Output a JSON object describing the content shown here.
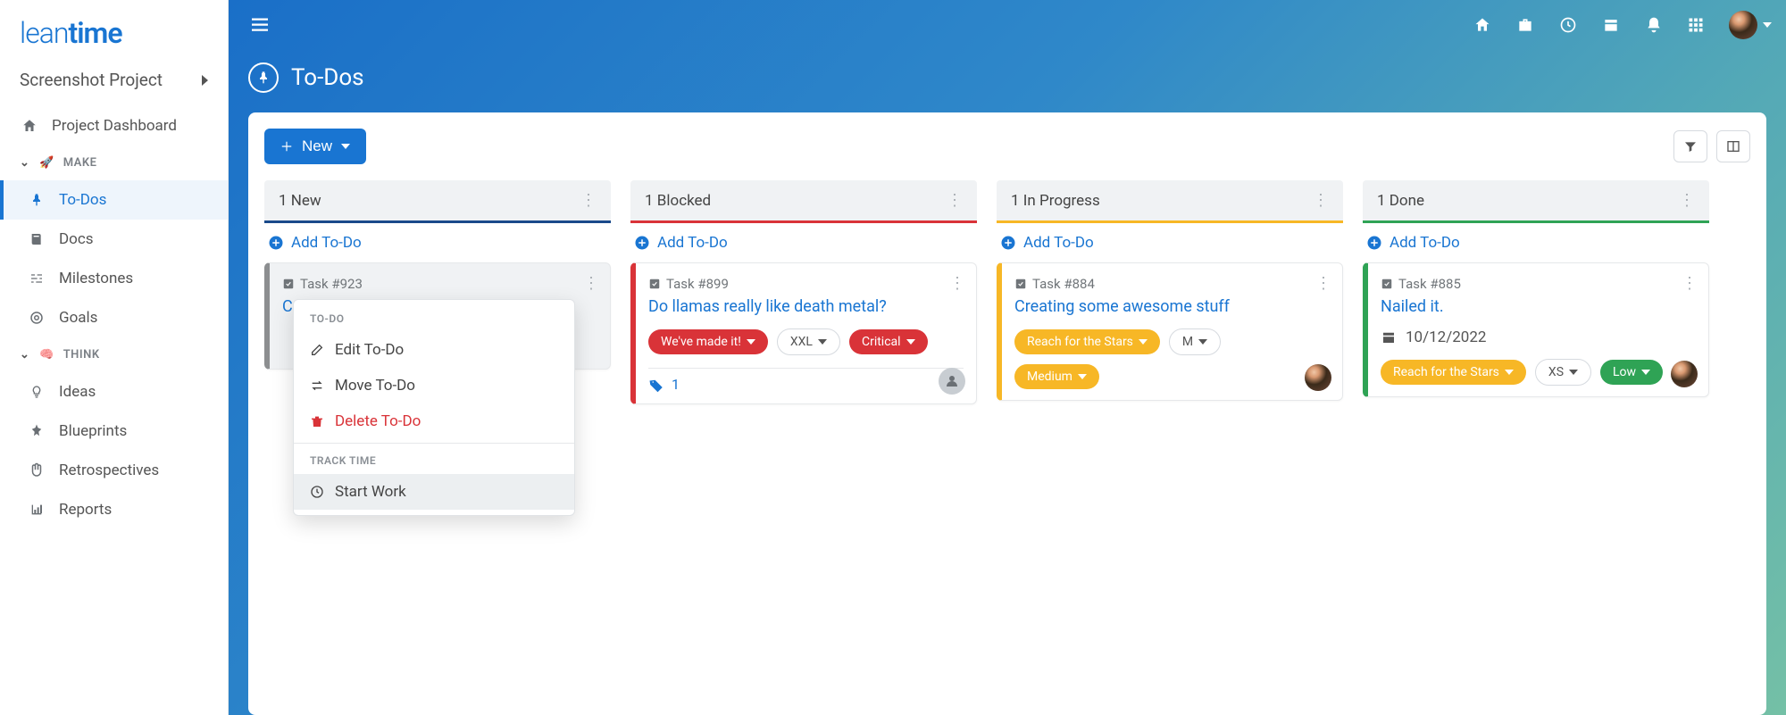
{
  "logo": {
    "part1": "lean",
    "part2": "time"
  },
  "project": "Screenshot Project",
  "sidebar": {
    "dashboard": "Project Dashboard",
    "make": {
      "label": "MAKE",
      "todos": "To-Dos",
      "docs": "Docs",
      "milestones": "Milestones",
      "goals": "Goals"
    },
    "think": {
      "label": "THINK",
      "ideas": "Ideas",
      "blueprints": "Blueprints",
      "retros": "Retrospectives",
      "reports": "Reports"
    }
  },
  "page": {
    "title": "To-Dos",
    "newBtn": "New"
  },
  "columns": {
    "new": {
      "title": "1 New",
      "add": "Add To-Do",
      "task": {
        "id": "Task #923",
        "titleFragment": "Cre"
      }
    },
    "blocked": {
      "title": "1 Blocked",
      "add": "Add To-Do",
      "task": {
        "id": "Task #899",
        "title": "Do llamas really like death metal?",
        "tag1": "We've made it!",
        "size": "XXL",
        "priority": "Critical",
        "comments": "1"
      }
    },
    "progress": {
      "title": "1 In Progress",
      "add": "Add To-Do",
      "task": {
        "id": "Task #884",
        "title": "Creating some awesome stuff",
        "tag1": "Reach for the Stars",
        "size": "M",
        "priority": "Medium"
      }
    },
    "done": {
      "title": "1 Done",
      "add": "Add To-Do",
      "task": {
        "id": "Task #885",
        "title": "Nailed it.",
        "date": "10/12/2022",
        "tag1": "Reach for the Stars",
        "size": "XS",
        "priority": "Low"
      }
    }
  },
  "dropdown": {
    "sec1": "TO-DO",
    "edit": "Edit To-Do",
    "move": "Move To-Do",
    "del": "Delete To-Do",
    "sec2": "TRACK TIME",
    "start": "Start Work"
  }
}
